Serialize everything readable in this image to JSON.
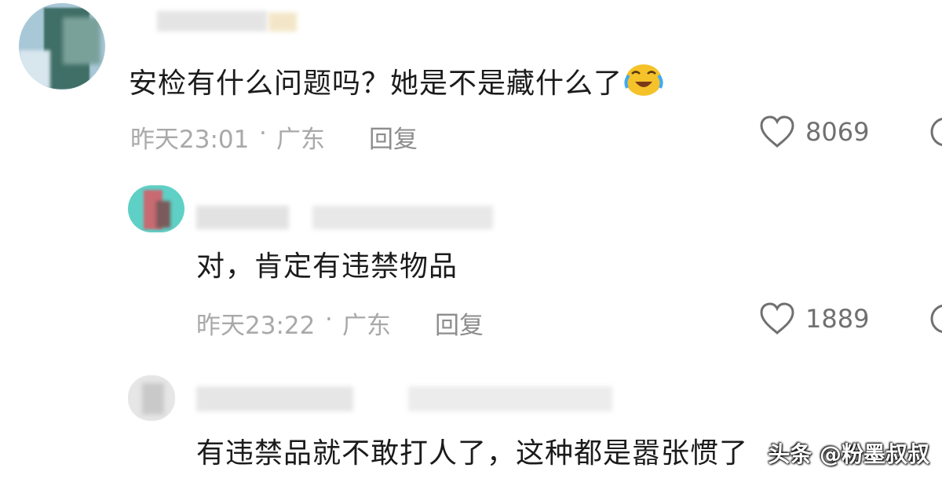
{
  "comments": [
    {
      "text": "安检有什么问题吗？她是不是藏什么了",
      "emoji": "crying-laughing-emoji",
      "time": "昨天23:01",
      "location": "广东",
      "separator": "·",
      "reply_label": "回复",
      "likes": "8069"
    },
    {
      "text": "对，肯定有违禁物品",
      "time": "昨天23:22",
      "location": "广东",
      "separator": "·",
      "reply_label": "回复",
      "likes": "1889"
    },
    {
      "text": "有违禁品就不敢打人了，这种都是嚣张惯了"
    }
  ],
  "watermark": "头条 @粉墨叔叔",
  "colors": {
    "meta_text": "#a9a9a9",
    "icon": "#707070",
    "avatar1": "#3b6a63",
    "avatar2": "#5fd0c6"
  }
}
